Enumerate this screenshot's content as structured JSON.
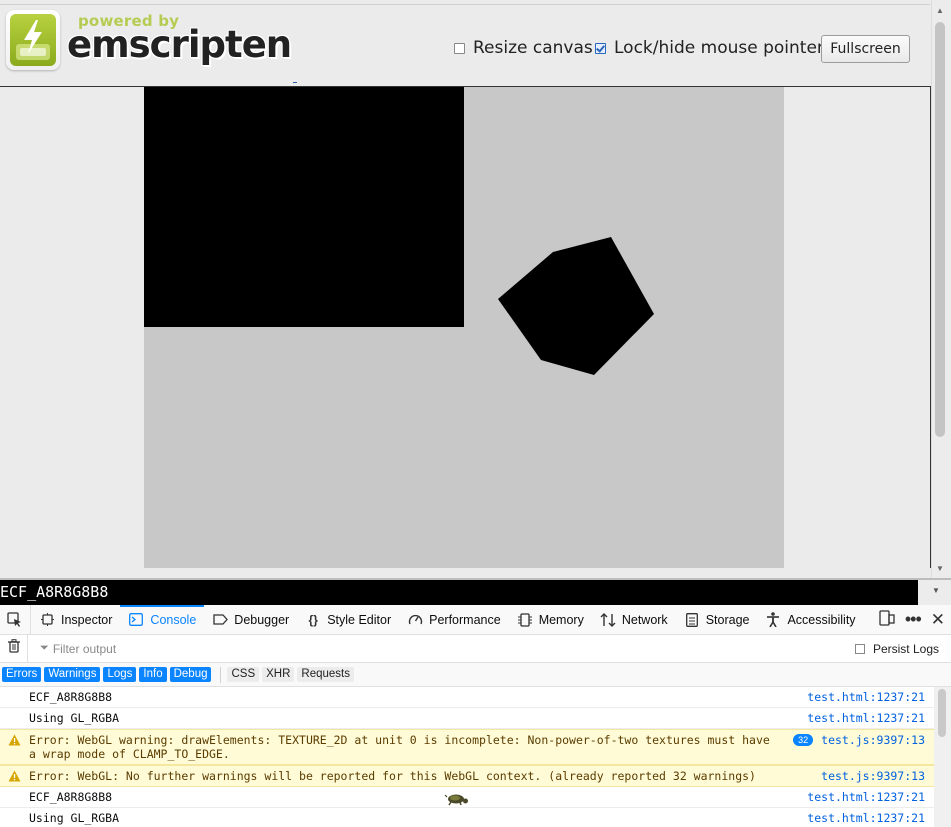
{
  "header": {
    "powered_by": "powered by",
    "brand": "emscripten",
    "resize_canvas_label": "Resize canvas",
    "resize_canvas_checked": false,
    "lock_pointer_label": "Lock/hide mouse pointer",
    "lock_pointer_checked": true,
    "fullscreen_label": "Fullscreen"
  },
  "output": {
    "text": "ECF_A8R8G8B8"
  },
  "devtools": {
    "tabs": [
      {
        "label": "Inspector",
        "icon": "inspector-icon"
      },
      {
        "label": "Console",
        "icon": "console-icon",
        "selected": true
      },
      {
        "label": "Debugger",
        "icon": "debugger-icon"
      },
      {
        "label": "Style Editor",
        "icon": "braces-icon"
      },
      {
        "label": "Performance",
        "icon": "gauge-icon"
      },
      {
        "label": "Memory",
        "icon": "memory-icon"
      },
      {
        "label": "Network",
        "icon": "network-arrows-icon"
      },
      {
        "label": "Storage",
        "icon": "storage-icon"
      },
      {
        "label": "Accessibility",
        "icon": "accessibility-icon"
      }
    ],
    "filter_placeholder": "Filter output",
    "persist_logs_label": "Persist Logs",
    "categories_on": [
      "Errors",
      "Warnings",
      "Logs",
      "Info",
      "Debug"
    ],
    "categories_off": [
      "CSS",
      "XHR",
      "Requests"
    ],
    "messages": [
      {
        "type": "log",
        "text": "ECF_A8R8G8B8",
        "source": "test.html:1237:21"
      },
      {
        "type": "log",
        "text": "Using GL_RGBA",
        "source": "test.html:1237:21"
      },
      {
        "type": "warn",
        "text": "Error: WebGL warning: drawElements: TEXTURE_2D at unit 0 is incomplete: Non-power-of-two textures must have\na wrap mode of CLAMP_TO_EDGE.",
        "count": "32",
        "source": "test.js:9397:13"
      },
      {
        "type": "warn",
        "text": "Error: WebGL: No further warnings will be reported for this WebGL context. (already reported 32 warnings)",
        "source": "test.js:9397:13"
      },
      {
        "type": "log",
        "text": "ECF_A8R8G8B8",
        "source": "test.html:1237:21"
      },
      {
        "type": "log",
        "text": "Using GL_RGBA",
        "source": "test.html:1237:21"
      }
    ]
  },
  "colors": {
    "accent": "#0a84ff",
    "brand_green": "#b5cc52",
    "canvas_bg": "#c8c8c8",
    "warning_bg": "#fffbd6"
  }
}
